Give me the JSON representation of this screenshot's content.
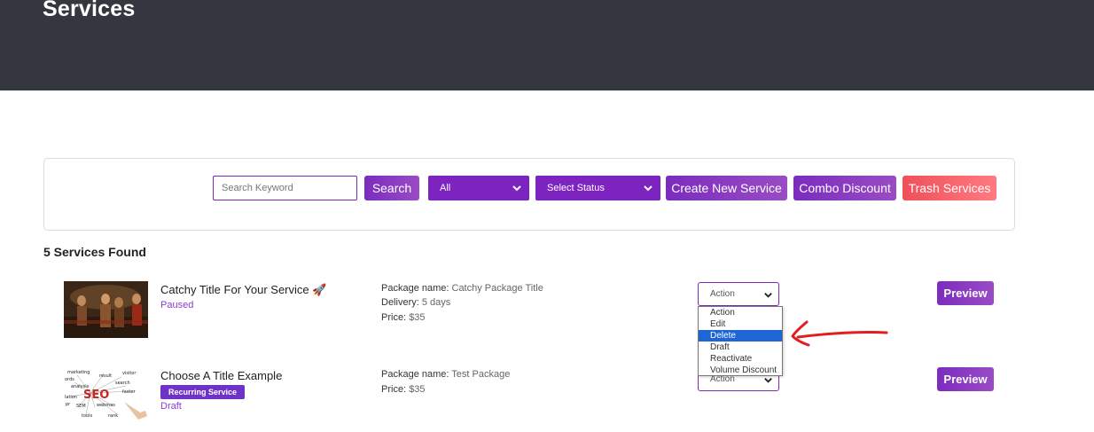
{
  "page": {
    "title": "Services"
  },
  "toolbar": {
    "search_placeholder": "Search Keyword",
    "search_label": "Search",
    "category_value": "All",
    "status_value": "Select Status",
    "create_label": "Create New Service",
    "combo_label": "Combo Discount",
    "trash_label": "Trash Services"
  },
  "results": {
    "count_label": "5 Services Found"
  },
  "services": [
    {
      "title": "Catchy Title For Your Service 🚀",
      "status": "Paused",
      "details": [
        {
          "label": "Package name:",
          "value": "Catchy Package Title"
        },
        {
          "label": "Delivery:",
          "value": "5 days"
        },
        {
          "label": "Price:",
          "value": "$35"
        }
      ],
      "action_value": "Action",
      "preview_label": "Preview"
    },
    {
      "title": "Choose A Title Example",
      "badge": "Recurring Service",
      "status": "Draft",
      "details": [
        {
          "label": "Package name:",
          "value": "Test Package"
        },
        {
          "label": "Price:",
          "value": "$35"
        }
      ],
      "action_value": "Action",
      "preview_label": "Preview"
    }
  ],
  "action_menu": {
    "options": [
      "Action",
      "Edit",
      "Delete",
      "Draft",
      "Reactivate",
      "Volume Discount"
    ],
    "selected": "Delete"
  },
  "thumbnail2_words": [
    "marketing",
    "result",
    "visitor",
    "ords",
    "search",
    "analysis",
    "SEO",
    "faster",
    "lation",
    "SEM",
    "webmas",
    "tools",
    "rank",
    "pr"
  ],
  "colors": {
    "header_bg": "#343740",
    "accent_purple": "#7b2cbf",
    "trash_red": "#f0505a",
    "selected_option": "#1e65d6",
    "annotation_arrow": "#e02020"
  },
  "icons": {
    "dropdown": "chevron-down-icon",
    "annotation": "red-arrow-annotation"
  }
}
